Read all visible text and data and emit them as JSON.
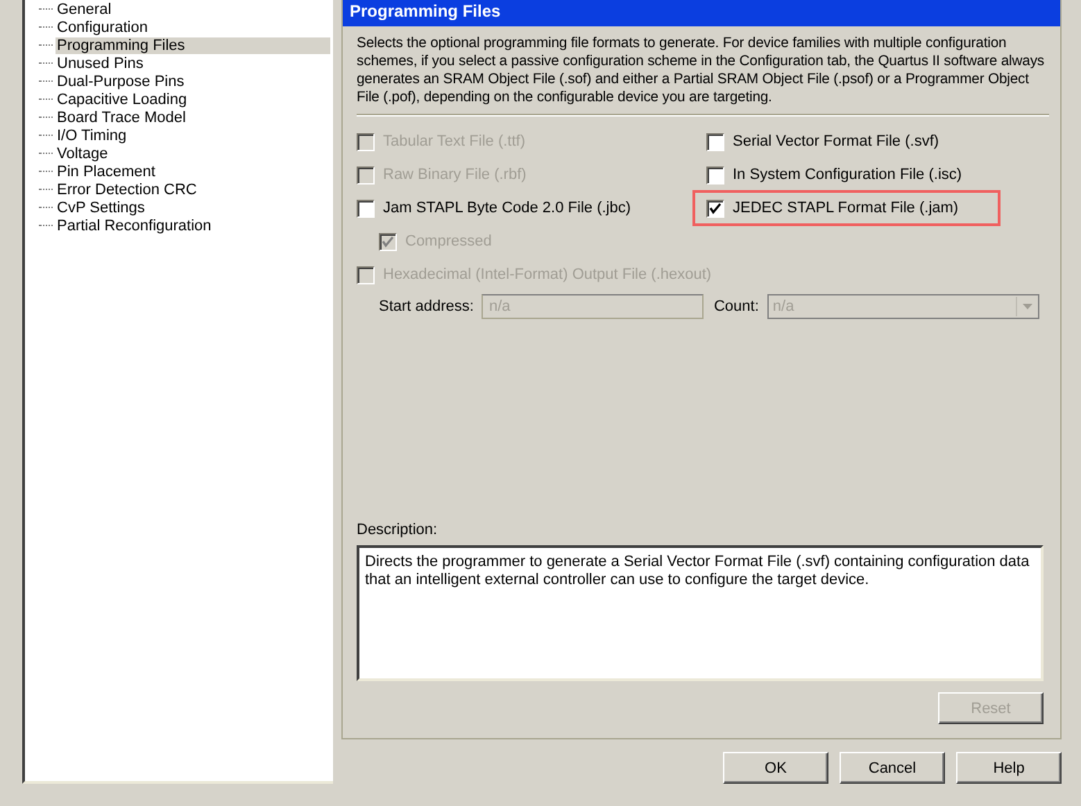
{
  "tree": {
    "items": [
      {
        "label": "General",
        "selected": false
      },
      {
        "label": "Configuration",
        "selected": false
      },
      {
        "label": "Programming Files",
        "selected": true
      },
      {
        "label": "Unused Pins",
        "selected": false
      },
      {
        "label": "Dual-Purpose Pins",
        "selected": false
      },
      {
        "label": "Capacitive Loading",
        "selected": false
      },
      {
        "label": "Board Trace Model",
        "selected": false
      },
      {
        "label": "I/O Timing",
        "selected": false
      },
      {
        "label": "Voltage",
        "selected": false
      },
      {
        "label": "Pin Placement",
        "selected": false
      },
      {
        "label": "Error Detection CRC",
        "selected": false
      },
      {
        "label": "CvP Settings",
        "selected": false
      },
      {
        "label": "Partial Reconfiguration",
        "selected": false
      }
    ]
  },
  "panel": {
    "title": "Programming Files",
    "intro": "Selects the optional programming file formats to generate. For device families with multiple configuration schemes, if you select a passive configuration scheme in the Configuration tab, the Quartus II software always generates an SRAM Object File (.sof) and either a Partial SRAM Object File (.psof) or a Programmer Object File (.pof), depending on the configurable device you are targeting.",
    "left_options": [
      {
        "kind": "main",
        "label": "Tabular Text File (.ttf)",
        "checked": false,
        "disabled": true,
        "highlighted": false
      },
      {
        "kind": "main",
        "label": "Raw Binary File (.rbf)",
        "checked": false,
        "disabled": true,
        "highlighted": false
      },
      {
        "kind": "main",
        "label": "Jam STAPL Byte Code 2.0 File (.jbc)",
        "checked": false,
        "disabled": false,
        "highlighted": false
      },
      {
        "kind": "sub",
        "label": "Compressed",
        "checked": true,
        "disabled": true,
        "highlighted": false
      }
    ],
    "right_options": [
      {
        "kind": "main",
        "label": "Serial Vector Format File (.svf)",
        "checked": false,
        "disabled": false,
        "highlighted": false
      },
      {
        "kind": "main",
        "label": "In System Configuration File (.isc)",
        "checked": false,
        "disabled": false,
        "highlighted": false
      },
      {
        "kind": "main",
        "label": "JEDEC STAPL Format File (.jam)",
        "checked": true,
        "disabled": false,
        "highlighted": true
      }
    ],
    "hex_option": {
      "label": "Hexadecimal (Intel-Format) Output File (.hexout)",
      "checked": false,
      "disabled": true
    },
    "start_address": {
      "label": "Start address:",
      "value": "n/a",
      "disabled": true
    },
    "count": {
      "label": "Count:",
      "value": "n/a",
      "disabled": true
    },
    "description_label": "Description:",
    "description": "Directs the programmer to generate a Serial Vector Format File (.svf) containing configuration data that an intelligent external controller can use to configure the target device.",
    "reset_button": {
      "label": "Reset",
      "disabled": true
    }
  },
  "buttons": [
    "OK",
    "Cancel",
    "Help"
  ]
}
